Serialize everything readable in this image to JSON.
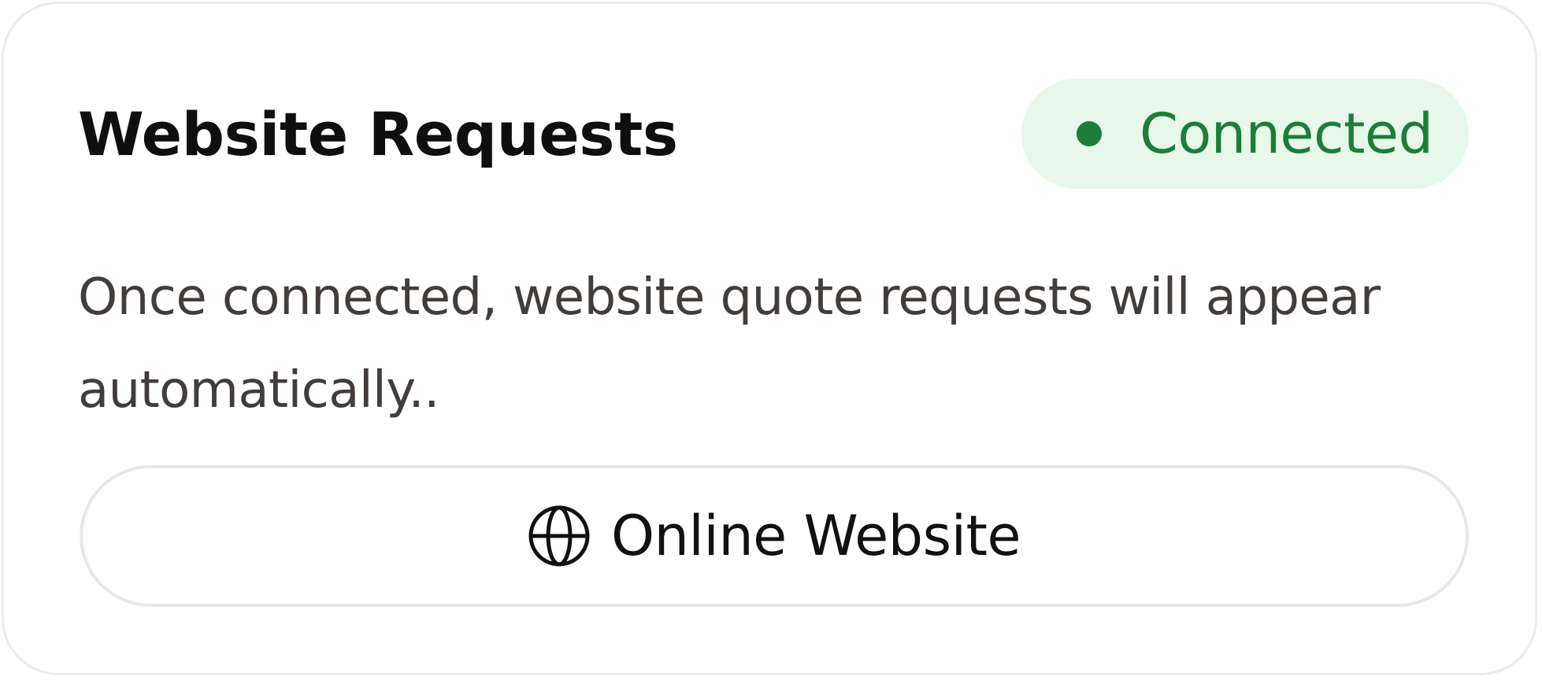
{
  "card": {
    "title": "Website Requests",
    "status": {
      "label": "Connected",
      "color": "#1e7d3a",
      "background": "#e7f8ea"
    },
    "description": "Once connected, website quote requests will appear automatically..",
    "button": {
      "label": "Online Website",
      "icon": "globe-icon"
    }
  }
}
